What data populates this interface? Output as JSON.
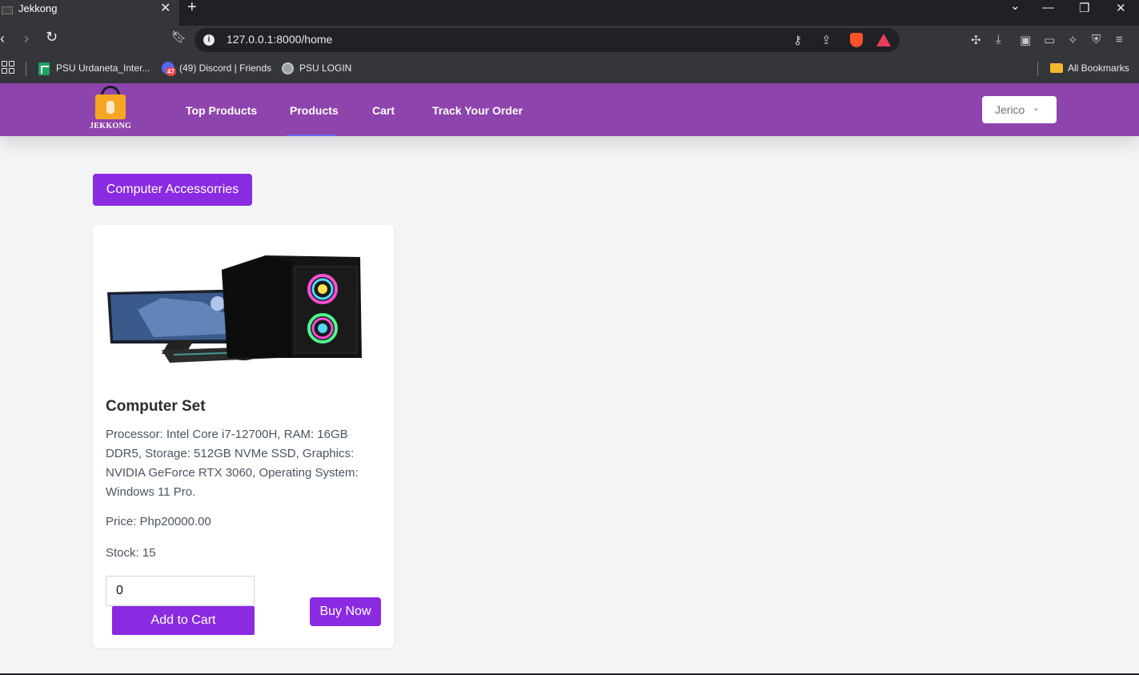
{
  "browser": {
    "tab_title": "Jekkong",
    "tab_close": "✕",
    "new_tab": "+",
    "url": "127.0.0.1:8000/home",
    "window_controls": {
      "list": "⌄",
      "minimize": "—",
      "restore": "❐",
      "close": "✕"
    }
  },
  "bookmarks": {
    "items": [
      {
        "label": "PSU Urdaneta_Inter...",
        "icon": "sheets-icon"
      },
      {
        "label": "(49) Discord | Friends",
        "icon": "discord-icon",
        "badge": "47"
      },
      {
        "label": "PSU LOGIN",
        "icon": "globe-icon"
      }
    ],
    "all_bookmarks": "All Bookmarks"
  },
  "site": {
    "logo_text": "JEKKONG",
    "nav": [
      "Top Products",
      "Products",
      "Cart",
      "Track Your Order"
    ],
    "active_nav": "Products",
    "user": "Jerico",
    "brand_color": "#8e44ad",
    "accent_color": "#8a2be2"
  },
  "category": "Computer Accessorries",
  "product": {
    "name": "Computer Set",
    "description": "Processor: Intel Core i7-12700H, RAM: 16GB DDR5, Storage: 512GB NVMe SSD, Graphics: NVIDIA GeForce RTX 3060, Operating System: Windows 11 Pro.",
    "price": "Price: Php20000.00",
    "stock": "Stock: 15",
    "quantity": "0",
    "add_to_cart": "Add to Cart",
    "buy_now": "Buy Now"
  }
}
